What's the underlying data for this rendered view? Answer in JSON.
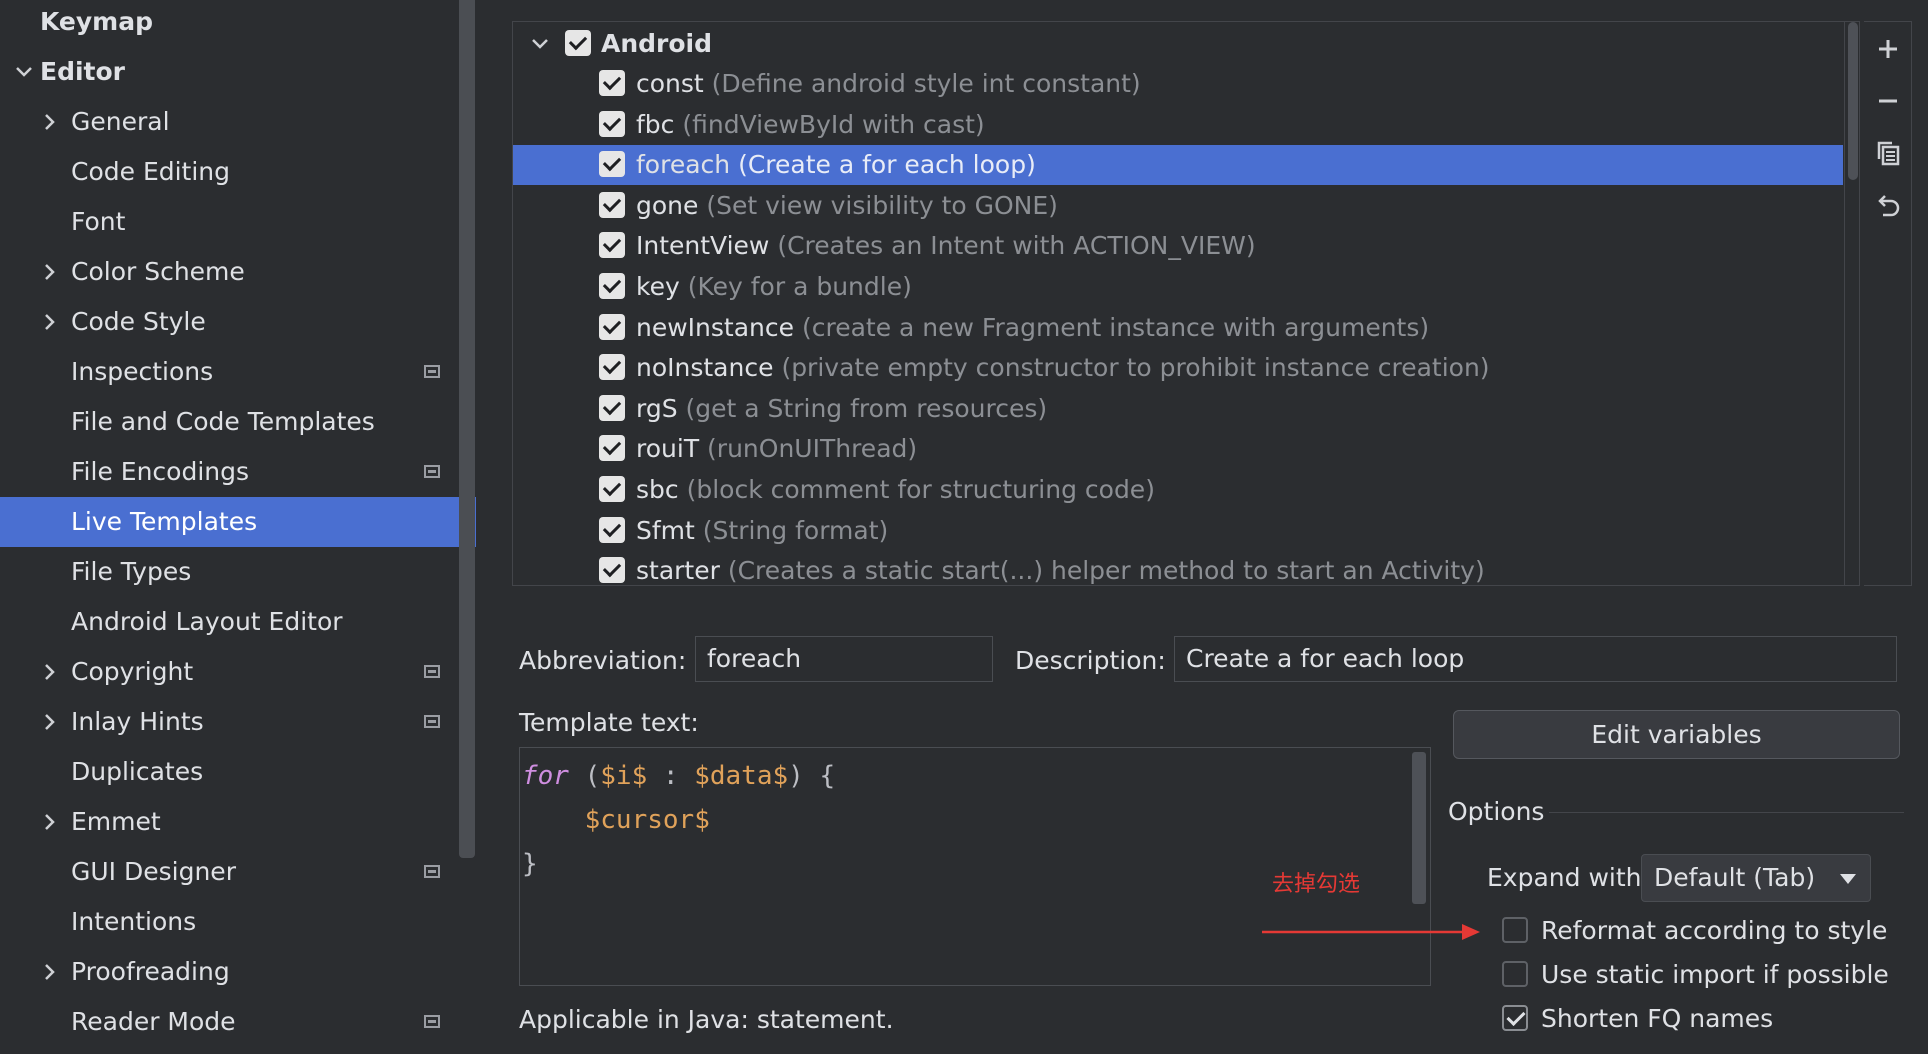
{
  "sidebar": {
    "items": [
      {
        "label": "Keymap",
        "level": 0,
        "chevron": "none",
        "project_icon": false,
        "selected": false
      },
      {
        "label": "Editor",
        "level": 0,
        "chevron": "down",
        "project_icon": false,
        "selected": false
      },
      {
        "label": "General",
        "level": 1,
        "chevron": "right",
        "project_icon": false,
        "selected": false
      },
      {
        "label": "Code Editing",
        "level": 1,
        "chevron": "none",
        "project_icon": false,
        "selected": false
      },
      {
        "label": "Font",
        "level": 1,
        "chevron": "none",
        "project_icon": false,
        "selected": false
      },
      {
        "label": "Color Scheme",
        "level": 1,
        "chevron": "right",
        "project_icon": false,
        "selected": false
      },
      {
        "label": "Code Style",
        "level": 1,
        "chevron": "right",
        "project_icon": false,
        "selected": false
      },
      {
        "label": "Inspections",
        "level": 1,
        "chevron": "none",
        "project_icon": true,
        "selected": false
      },
      {
        "label": "File and Code Templates",
        "level": 1,
        "chevron": "none",
        "project_icon": false,
        "selected": false
      },
      {
        "label": "File Encodings",
        "level": 1,
        "chevron": "none",
        "project_icon": true,
        "selected": false
      },
      {
        "label": "Live Templates",
        "level": 1,
        "chevron": "none",
        "project_icon": false,
        "selected": true
      },
      {
        "label": "File Types",
        "level": 1,
        "chevron": "none",
        "project_icon": false,
        "selected": false
      },
      {
        "label": "Android Layout Editor",
        "level": 1,
        "chevron": "none",
        "project_icon": false,
        "selected": false
      },
      {
        "label": "Copyright",
        "level": 1,
        "chevron": "right",
        "project_icon": true,
        "selected": false
      },
      {
        "label": "Inlay Hints",
        "level": 1,
        "chevron": "right",
        "project_icon": true,
        "selected": false
      },
      {
        "label": "Duplicates",
        "level": 1,
        "chevron": "none",
        "project_icon": false,
        "selected": false
      },
      {
        "label": "Emmet",
        "level": 1,
        "chevron": "right",
        "project_icon": false,
        "selected": false
      },
      {
        "label": "GUI Designer",
        "level": 1,
        "chevron": "none",
        "project_icon": true,
        "selected": false
      },
      {
        "label": "Intentions",
        "level": 1,
        "chevron": "none",
        "project_icon": false,
        "selected": false
      },
      {
        "label": "Proofreading",
        "level": 1,
        "chevron": "right",
        "project_icon": false,
        "selected": false
      },
      {
        "label": "Reader Mode",
        "level": 1,
        "chevron": "none",
        "project_icon": true,
        "selected": false
      }
    ]
  },
  "templates": {
    "group": {
      "name": "Android",
      "checked": true,
      "expanded": true
    },
    "items": [
      {
        "name": "const",
        "desc": "(Define android style int constant)",
        "checked": true,
        "selected": false
      },
      {
        "name": "fbc",
        "desc": "(findViewById with cast)",
        "checked": true,
        "selected": false
      },
      {
        "name": "foreach",
        "desc": "(Create a for each loop)",
        "checked": true,
        "selected": true
      },
      {
        "name": "gone",
        "desc": "(Set view visibility to GONE)",
        "checked": true,
        "selected": false
      },
      {
        "name": "IntentView",
        "desc": "(Creates an Intent with ACTION_VIEW)",
        "checked": true,
        "selected": false
      },
      {
        "name": "key",
        "desc": "(Key for a bundle)",
        "checked": true,
        "selected": false
      },
      {
        "name": "newInstance",
        "desc": "(create a new Fragment instance with arguments)",
        "checked": true,
        "selected": false
      },
      {
        "name": "noInstance",
        "desc": "(private empty constructor to prohibit instance creation)",
        "checked": true,
        "selected": false
      },
      {
        "name": "rgS",
        "desc": "(get a String from resources)",
        "checked": true,
        "selected": false
      },
      {
        "name": "rouiT",
        "desc": "(runOnUIThread)",
        "checked": true,
        "selected": false
      },
      {
        "name": "sbc",
        "desc": "(block comment for structuring code)",
        "checked": true,
        "selected": false
      },
      {
        "name": "Sfmt",
        "desc": "(String format)",
        "checked": true,
        "selected": false
      },
      {
        "name": "starter",
        "desc": "(Creates a static start(...) helper method to start an Activity)",
        "checked": true,
        "selected": false
      }
    ]
  },
  "toolbar": {
    "add_icon": "plus-icon",
    "remove_icon": "minus-icon",
    "copy_icon": "copy-icon",
    "restore_icon": "undo-icon"
  },
  "form": {
    "abbreviation_label": "Abbreviation:",
    "abbreviation_value": "foreach",
    "description_label": "Description:",
    "description_value": "Create a for each loop",
    "template_text_label": "Template text:",
    "code": {
      "kw": "for",
      "open": " (",
      "var1": "$i$",
      "sep": " : ",
      "var2": "$data$",
      "close": ") {",
      "indent": "    ",
      "cursor": "$cursor$",
      "end": "}"
    },
    "applicable": "Applicable in Java: statement.",
    "edit_variables": "Edit variables"
  },
  "options": {
    "title": "Options",
    "expand_label": "Expand with",
    "expand_value": "Default (Tab)",
    "checkboxes": [
      {
        "label": "Reformat according to style",
        "checked": false
      },
      {
        "label": "Use static import if possible",
        "checked": false
      },
      {
        "label": "Shorten FQ names",
        "checked": true
      }
    ]
  },
  "annotation": {
    "text": "去掉勾选",
    "color": "#e53935"
  },
  "colors": {
    "accent": "#4a6fd1",
    "background": "#2b2d30"
  }
}
